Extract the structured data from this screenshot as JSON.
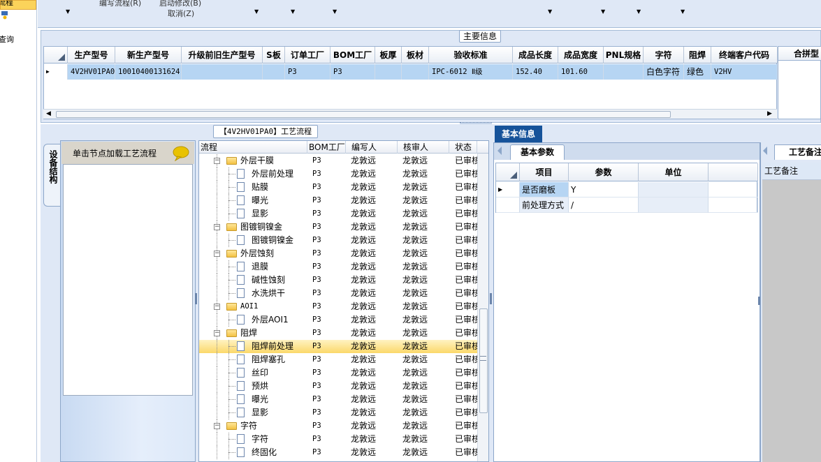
{
  "left_nav": {
    "selected_label": "流程",
    "item_label": "查询"
  },
  "toolbar": {
    "line1": "编写流程(R)",
    "line2": "启动修改(B)",
    "cancel": "取消(Z)"
  },
  "main_info": {
    "title": "主要信息",
    "columns": [
      "生产型号",
      "新生产型号",
      "升级前旧生产型号",
      "S板",
      "订单工厂",
      "BOM工厂",
      "板厚",
      "板材",
      "验收标准",
      "成品长度",
      "成品宽度",
      "PNL规格",
      "字符",
      "阻焊",
      "终端客户代码"
    ],
    "row": [
      "4V2HV01PA0",
      "10010400131624",
      "",
      "",
      "P3",
      "P3",
      "",
      "",
      "IPC-6012 Ⅱ级",
      "152.40",
      "101.60",
      "",
      "白色字符",
      "绿色",
      "V2HV"
    ],
    "side_column": "合拼型"
  },
  "structure_panel": {
    "tab_label": "设备结构",
    "hint": "单击节点加载工艺流程"
  },
  "flow_panel": {
    "title": "【4V2HV01PA0】工艺流程",
    "columns": [
      "流程",
      "BOM工厂",
      "编写人",
      "核审人",
      "状态"
    ],
    "rows": [
      {
        "name": "外层干膜",
        "level": 0,
        "type": "folder",
        "bom": "P3",
        "writer": "龙敦远",
        "reviewer": "龙敦远",
        "status": "已审核"
      },
      {
        "name": "外层前处理",
        "level": 1,
        "type": "doc",
        "bom": "P3",
        "writer": "龙敦远",
        "reviewer": "龙敦远",
        "status": "已审核"
      },
      {
        "name": "贴膜",
        "level": 1,
        "type": "doc",
        "bom": "P3",
        "writer": "龙敦远",
        "reviewer": "龙敦远",
        "status": "已审核"
      },
      {
        "name": "曝光",
        "level": 1,
        "type": "doc",
        "bom": "P3",
        "writer": "龙敦远",
        "reviewer": "龙敦远",
        "status": "已审核"
      },
      {
        "name": "显影",
        "level": 1,
        "type": "doc",
        "bom": "P3",
        "writer": "龙敦远",
        "reviewer": "龙敦远",
        "status": "已审核"
      },
      {
        "name": "图镀铜镍金",
        "level": 0,
        "type": "folder",
        "bom": "P3",
        "writer": "龙敦远",
        "reviewer": "龙敦远",
        "status": "已审核"
      },
      {
        "name": "图镀铜镍金",
        "level": 1,
        "type": "doc",
        "bom": "P3",
        "writer": "龙敦远",
        "reviewer": "龙敦远",
        "status": "已审核"
      },
      {
        "name": "外层蚀刻",
        "level": 0,
        "type": "folder",
        "bom": "P3",
        "writer": "龙敦远",
        "reviewer": "龙敦远",
        "status": "已审核"
      },
      {
        "name": "退膜",
        "level": 1,
        "type": "doc",
        "bom": "P3",
        "writer": "龙敦远",
        "reviewer": "龙敦远",
        "status": "已审核"
      },
      {
        "name": "碱性蚀刻",
        "level": 1,
        "type": "doc",
        "bom": "P3",
        "writer": "龙敦远",
        "reviewer": "龙敦远",
        "status": "已审核"
      },
      {
        "name": "水洗烘干",
        "level": 1,
        "type": "doc",
        "bom": "P3",
        "writer": "龙敦远",
        "reviewer": "龙敦远",
        "status": "已审核"
      },
      {
        "name": "AOI1",
        "level": 0,
        "type": "folder",
        "bom": "P3",
        "writer": "龙敦远",
        "reviewer": "龙敦远",
        "status": "已审核"
      },
      {
        "name": "外层AOI1",
        "level": 1,
        "type": "doc",
        "bom": "P3",
        "writer": "龙敦远",
        "reviewer": "龙敦远",
        "status": "已审核"
      },
      {
        "name": "阻焊",
        "level": 0,
        "type": "folder",
        "bom": "P3",
        "writer": "龙敦远",
        "reviewer": "龙敦远",
        "status": "已审核"
      },
      {
        "name": "阻焊前处理",
        "level": 1,
        "type": "doc",
        "bom": "P3",
        "writer": "龙敦远",
        "reviewer": "龙敦远",
        "status": "已审核",
        "selected": true
      },
      {
        "name": "阻焊塞孔",
        "level": 1,
        "type": "doc",
        "bom": "P3",
        "writer": "龙敦远",
        "reviewer": "龙敦远",
        "status": "已审核"
      },
      {
        "name": "丝印",
        "level": 1,
        "type": "doc",
        "bom": "P3",
        "writer": "龙敦远",
        "reviewer": "龙敦远",
        "status": "已审核"
      },
      {
        "name": "预烘",
        "level": 1,
        "type": "doc",
        "bom": "P3",
        "writer": "龙敦远",
        "reviewer": "龙敦远",
        "status": "已审核"
      },
      {
        "name": "曝光",
        "level": 1,
        "type": "doc",
        "bom": "P3",
        "writer": "龙敦远",
        "reviewer": "龙敦远",
        "status": "已审核"
      },
      {
        "name": "显影",
        "level": 1,
        "type": "doc",
        "bom": "P3",
        "writer": "龙敦远",
        "reviewer": "龙敦远",
        "status": "已审核"
      },
      {
        "name": "字符",
        "level": 0,
        "type": "folder",
        "bom": "P3",
        "writer": "龙敦远",
        "reviewer": "龙敦远",
        "status": "已审核"
      },
      {
        "name": "字符",
        "level": 1,
        "type": "doc",
        "bom": "P3",
        "writer": "龙敦远",
        "reviewer": "龙敦远",
        "status": "已审核"
      },
      {
        "name": "终固化",
        "level": 1,
        "type": "doc",
        "bom": "P3",
        "writer": "龙敦远",
        "reviewer": "龙敦远",
        "status": "已审核"
      }
    ]
  },
  "basic_info": {
    "title": "基本信息",
    "tab": "基本参数",
    "columns": [
      "项目",
      "参数",
      "单位"
    ],
    "rows": [
      {
        "item": "是否磨板",
        "param": "Y",
        "unit": ""
      },
      {
        "item": "前处理方式",
        "param": "/",
        "unit": ""
      }
    ]
  },
  "remark": {
    "tab": "工艺备注",
    "label": "工艺备注"
  },
  "colors": {
    "selection_blue": "#b6d5f3",
    "selection_gold": "#fbd86a",
    "panel_bg": "#dfe8f6",
    "header_blue": "#16539a"
  }
}
